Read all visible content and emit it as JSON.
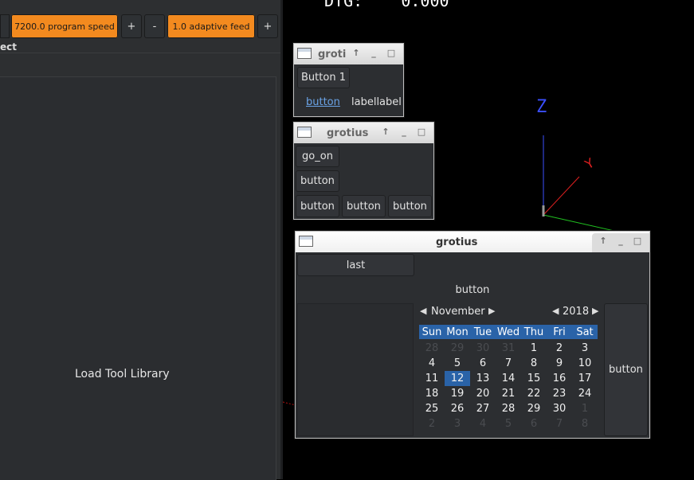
{
  "toolbar": {
    "program_speed": "7200.0 program speed",
    "plus": "+",
    "minus": "-",
    "adaptive_feed": "1.0 adaptive feed",
    "plus2": "+"
  },
  "left": {
    "section_label": "ect",
    "load_tool_library": "Load Tool Library"
  },
  "dro": {
    "label": "DTG:",
    "value": "0.000"
  },
  "axes": {
    "z": "Z",
    "y": "Y"
  },
  "win1": {
    "title": "groti",
    "button1": "Button 1",
    "link": "button",
    "label": "labellabel"
  },
  "win2": {
    "title": "grotius",
    "go_on": "go_on",
    "button": "button",
    "row": [
      "button",
      "button",
      "button"
    ]
  },
  "win3": {
    "title": "grotius",
    "last": "last",
    "button_center": "button",
    "button_right": "button",
    "calendar": {
      "month": "November",
      "year": "2018",
      "weekdays": [
        "Sun",
        "Mon",
        "Tue",
        "Wed",
        "Thu",
        "Fri",
        "Sat"
      ],
      "rows": [
        [
          "28",
          "29",
          "30",
          "31",
          "1",
          "2",
          "3"
        ],
        [
          "4",
          "5",
          "6",
          "7",
          "8",
          "9",
          "10"
        ],
        [
          "11",
          "12",
          "13",
          "14",
          "15",
          "16",
          "17"
        ],
        [
          "18",
          "19",
          "20",
          "21",
          "22",
          "23",
          "24"
        ],
        [
          "25",
          "26",
          "27",
          "28",
          "29",
          "30",
          "1"
        ],
        [
          "2",
          "3",
          "4",
          "5",
          "6",
          "7",
          "8"
        ]
      ],
      "selected": "12"
    }
  },
  "colors": {
    "accent_orange": "#f38a1f",
    "selection_blue": "#2a63a8"
  }
}
